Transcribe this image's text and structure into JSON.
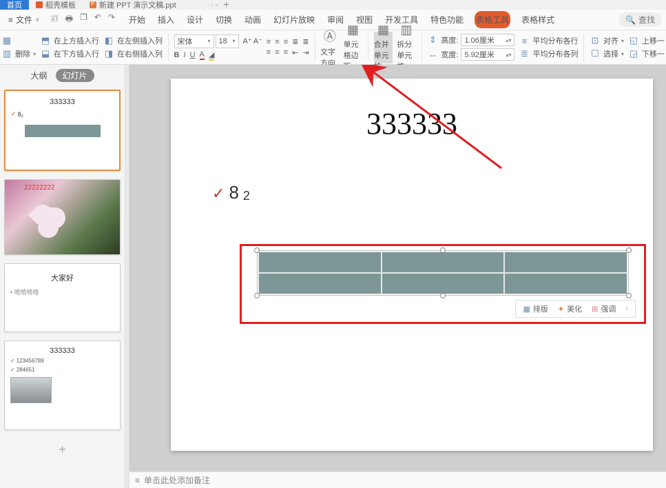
{
  "tabs": {
    "home": "首页",
    "doc1": "稻壳模板",
    "doc2": "新建 PPT 演示文稿.ppt"
  },
  "file_menu": "文件",
  "menus": {
    "start": "开始",
    "insert": "插入",
    "design": "设计",
    "transition": "切换",
    "anim": "动画",
    "slideshow": "幻灯片放映",
    "review": "审阅",
    "view": "视图",
    "dev": "开发工具",
    "feature": "特色功能",
    "tabletool": "表格工具",
    "tablestyle": "表格样式"
  },
  "search_placeholder": "查找",
  "ribbon": {
    "ins_above": "在上方插入行",
    "ins_left": "在左侧插入列",
    "delete": "删除",
    "ins_below": "在下方插入行",
    "ins_right": "在右侧插入列",
    "font_name": "宋体",
    "font_size": "18",
    "textdir": "文字方向",
    "cellmargin": "单元格边距",
    "merge": "合并单元格",
    "split": "拆分单元格",
    "height_label": "高度:",
    "height_val": "1.06厘米",
    "width_label": "宽度:",
    "width_val": "5.92厘米",
    "dist_rows": "平均分布各行",
    "dist_cols": "平均分布各列",
    "align": "对齐",
    "moveup": "上移一",
    "select": "选择",
    "movedown": "下移一"
  },
  "side": {
    "outline": "大纲",
    "slides": "幻灯片"
  },
  "slide": {
    "title": "333333",
    "bullet_main": "8",
    "bullet_sub": "2"
  },
  "thumbs": {
    "t1_title": "333333",
    "t1_bullet": "8₂",
    "t2_text": "22222222",
    "t3_title": "大家好",
    "t3_bullet": "哈哈哈哈",
    "t4_title": "333333",
    "t4_b1": "123456789",
    "t4_b2": "284651"
  },
  "floatbar": {
    "layout": "排版",
    "beautify": "美化",
    "emphasis": "强调"
  },
  "notes_placeholder": "单击此处添加备注",
  "colors": {
    "accent": "#e25b2e",
    "highlight": "#e02020",
    "tablefill": "#7d9797"
  }
}
